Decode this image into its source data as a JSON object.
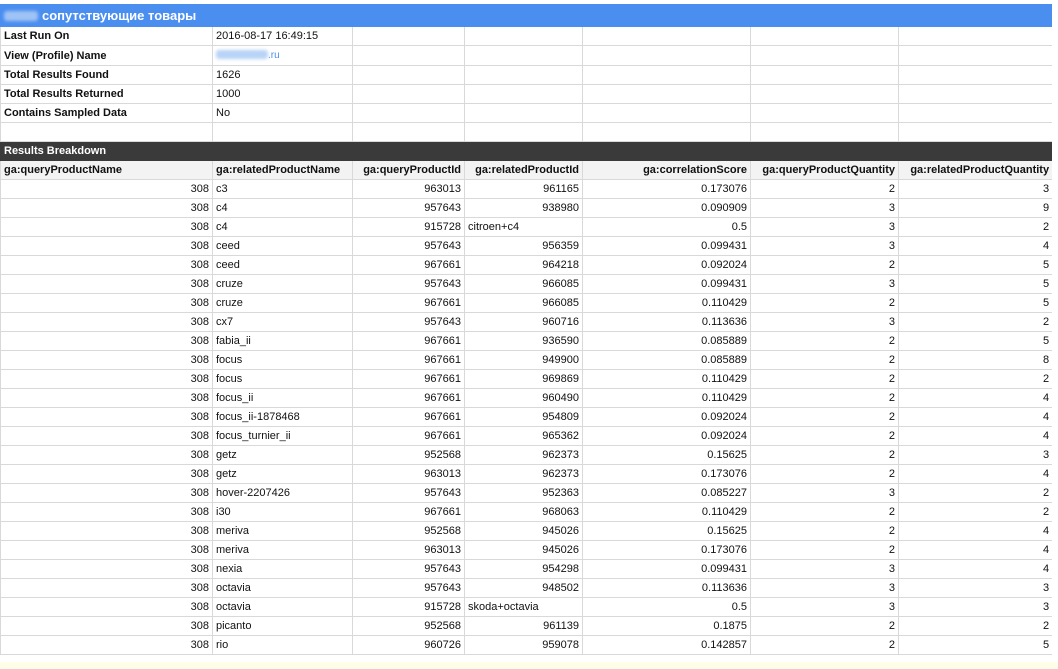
{
  "report": {
    "title": "сопутствующие товары",
    "meta": [
      {
        "label": "Last Run On",
        "value": "2016-08-17 16:49:15"
      },
      {
        "label": "View (Profile) Name",
        "value": ".ru"
      },
      {
        "label": "Total Results Found",
        "value": "1626"
      },
      {
        "label": "Total Results Returned",
        "value": "1000"
      },
      {
        "label": "Contains Sampled Data",
        "value": "No"
      }
    ],
    "section_title": "Results Breakdown",
    "columns": [
      "ga:queryProductName",
      "ga:relatedProductName",
      "ga:queryProductId",
      "ga:relatedProductId",
      "ga:correlationScore",
      "ga:queryProductQuantity",
      "ga:relatedProductQuantity"
    ],
    "rows": [
      [
        "308",
        "c3",
        "963013",
        "961165",
        "0.173076",
        "2",
        "3"
      ],
      [
        "308",
        "c4",
        "957643",
        "938980",
        "0.090909",
        "3",
        "9"
      ],
      [
        "308",
        "c4",
        "915728",
        "citroen+c4",
        "0.5",
        "3",
        "2"
      ],
      [
        "308",
        "ceed",
        "957643",
        "956359",
        "0.099431",
        "3",
        "4"
      ],
      [
        "308",
        "ceed",
        "967661",
        "964218",
        "0.092024",
        "2",
        "5"
      ],
      [
        "308",
        "cruze",
        "957643",
        "966085",
        "0.099431",
        "3",
        "5"
      ],
      [
        "308",
        "cruze",
        "967661",
        "966085",
        "0.110429",
        "2",
        "5"
      ],
      [
        "308",
        "cx7",
        "957643",
        "960716",
        "0.113636",
        "3",
        "2"
      ],
      [
        "308",
        "fabia_ii",
        "967661",
        "936590",
        "0.085889",
        "2",
        "5"
      ],
      [
        "308",
        "focus",
        "967661",
        "949900",
        "0.085889",
        "2",
        "8"
      ],
      [
        "308",
        "focus",
        "967661",
        "969869",
        "0.110429",
        "2",
        "2"
      ],
      [
        "308",
        "focus_ii",
        "967661",
        "960490",
        "0.110429",
        "2",
        "4"
      ],
      [
        "308",
        "focus_ii-1878468",
        "967661",
        "954809",
        "0.092024",
        "2",
        "4"
      ],
      [
        "308",
        "focus_turnier_ii",
        "967661",
        "965362",
        "0.092024",
        "2",
        "4"
      ],
      [
        "308",
        "getz",
        "952568",
        "962373",
        "0.15625",
        "2",
        "3"
      ],
      [
        "308",
        "getz",
        "963013",
        "962373",
        "0.173076",
        "2",
        "4"
      ],
      [
        "308",
        "hover-2207426",
        "957643",
        "952363",
        "0.085227",
        "3",
        "2"
      ],
      [
        "308",
        "i30",
        "967661",
        "968063",
        "0.110429",
        "2",
        "2"
      ],
      [
        "308",
        "meriva",
        "952568",
        "945026",
        "0.15625",
        "2",
        "4"
      ],
      [
        "308",
        "meriva",
        "963013",
        "945026",
        "0.173076",
        "2",
        "4"
      ],
      [
        "308",
        "nexia",
        "957643",
        "954298",
        "0.099431",
        "3",
        "4"
      ],
      [
        "308",
        "octavia",
        "957643",
        "948502",
        "0.113636",
        "3",
        "3"
      ],
      [
        "308",
        "octavia",
        "915728",
        "skoda+octavia",
        "0.5",
        "3",
        "3"
      ],
      [
        "308",
        "picanto",
        "952568",
        "961139",
        "0.1875",
        "2",
        "2"
      ],
      [
        "308",
        "rio",
        "960726",
        "959078",
        "0.142857",
        "2",
        "5"
      ]
    ]
  },
  "colors": {
    "title_bar": "#4a8ef0",
    "section_bar": "#3a3a3a"
  }
}
